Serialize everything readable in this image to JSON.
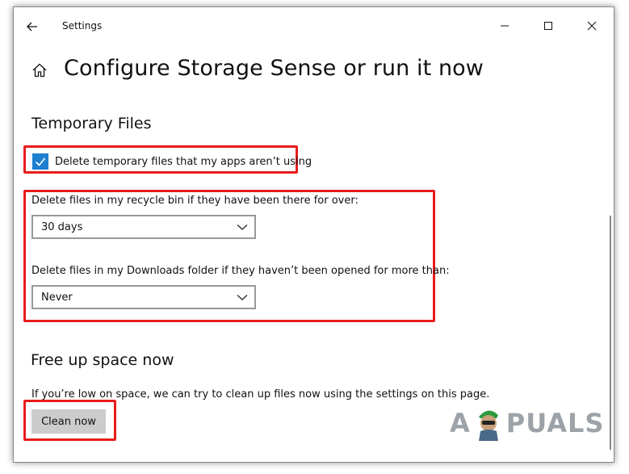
{
  "window": {
    "title": "Settings"
  },
  "page": {
    "title": "Configure Storage Sense or run it now"
  },
  "temporary_files": {
    "heading": "Temporary Files",
    "delete_temp_checkbox": {
      "label": "Delete temporary files that my apps aren’t using",
      "checked": true
    },
    "recycle_bin": {
      "label": "Delete files in my recycle bin if they have been there for over:",
      "selected": "30 days"
    },
    "downloads": {
      "label": "Delete files in my Downloads folder if they haven’t been opened for more than:",
      "selected": "Never"
    }
  },
  "free_up": {
    "heading": "Free up space now",
    "description": "If you’re low on space, we can try to clean up files now using the settings on this page.",
    "button_label": "Clean now"
  },
  "watermark": {
    "text_left": "A",
    "text_right": "PUALS"
  },
  "colors": {
    "accent": "#1e7fd0",
    "highlight": "#e81c1c",
    "button_bg": "#cccccc"
  },
  "icons": {
    "back": "back-arrow-icon",
    "home": "home-icon",
    "minimize": "minimize-icon",
    "maximize": "maximize-icon",
    "close": "close-icon",
    "checkmark": "checkmark-icon",
    "dropdown": "chevron-down-icon"
  }
}
